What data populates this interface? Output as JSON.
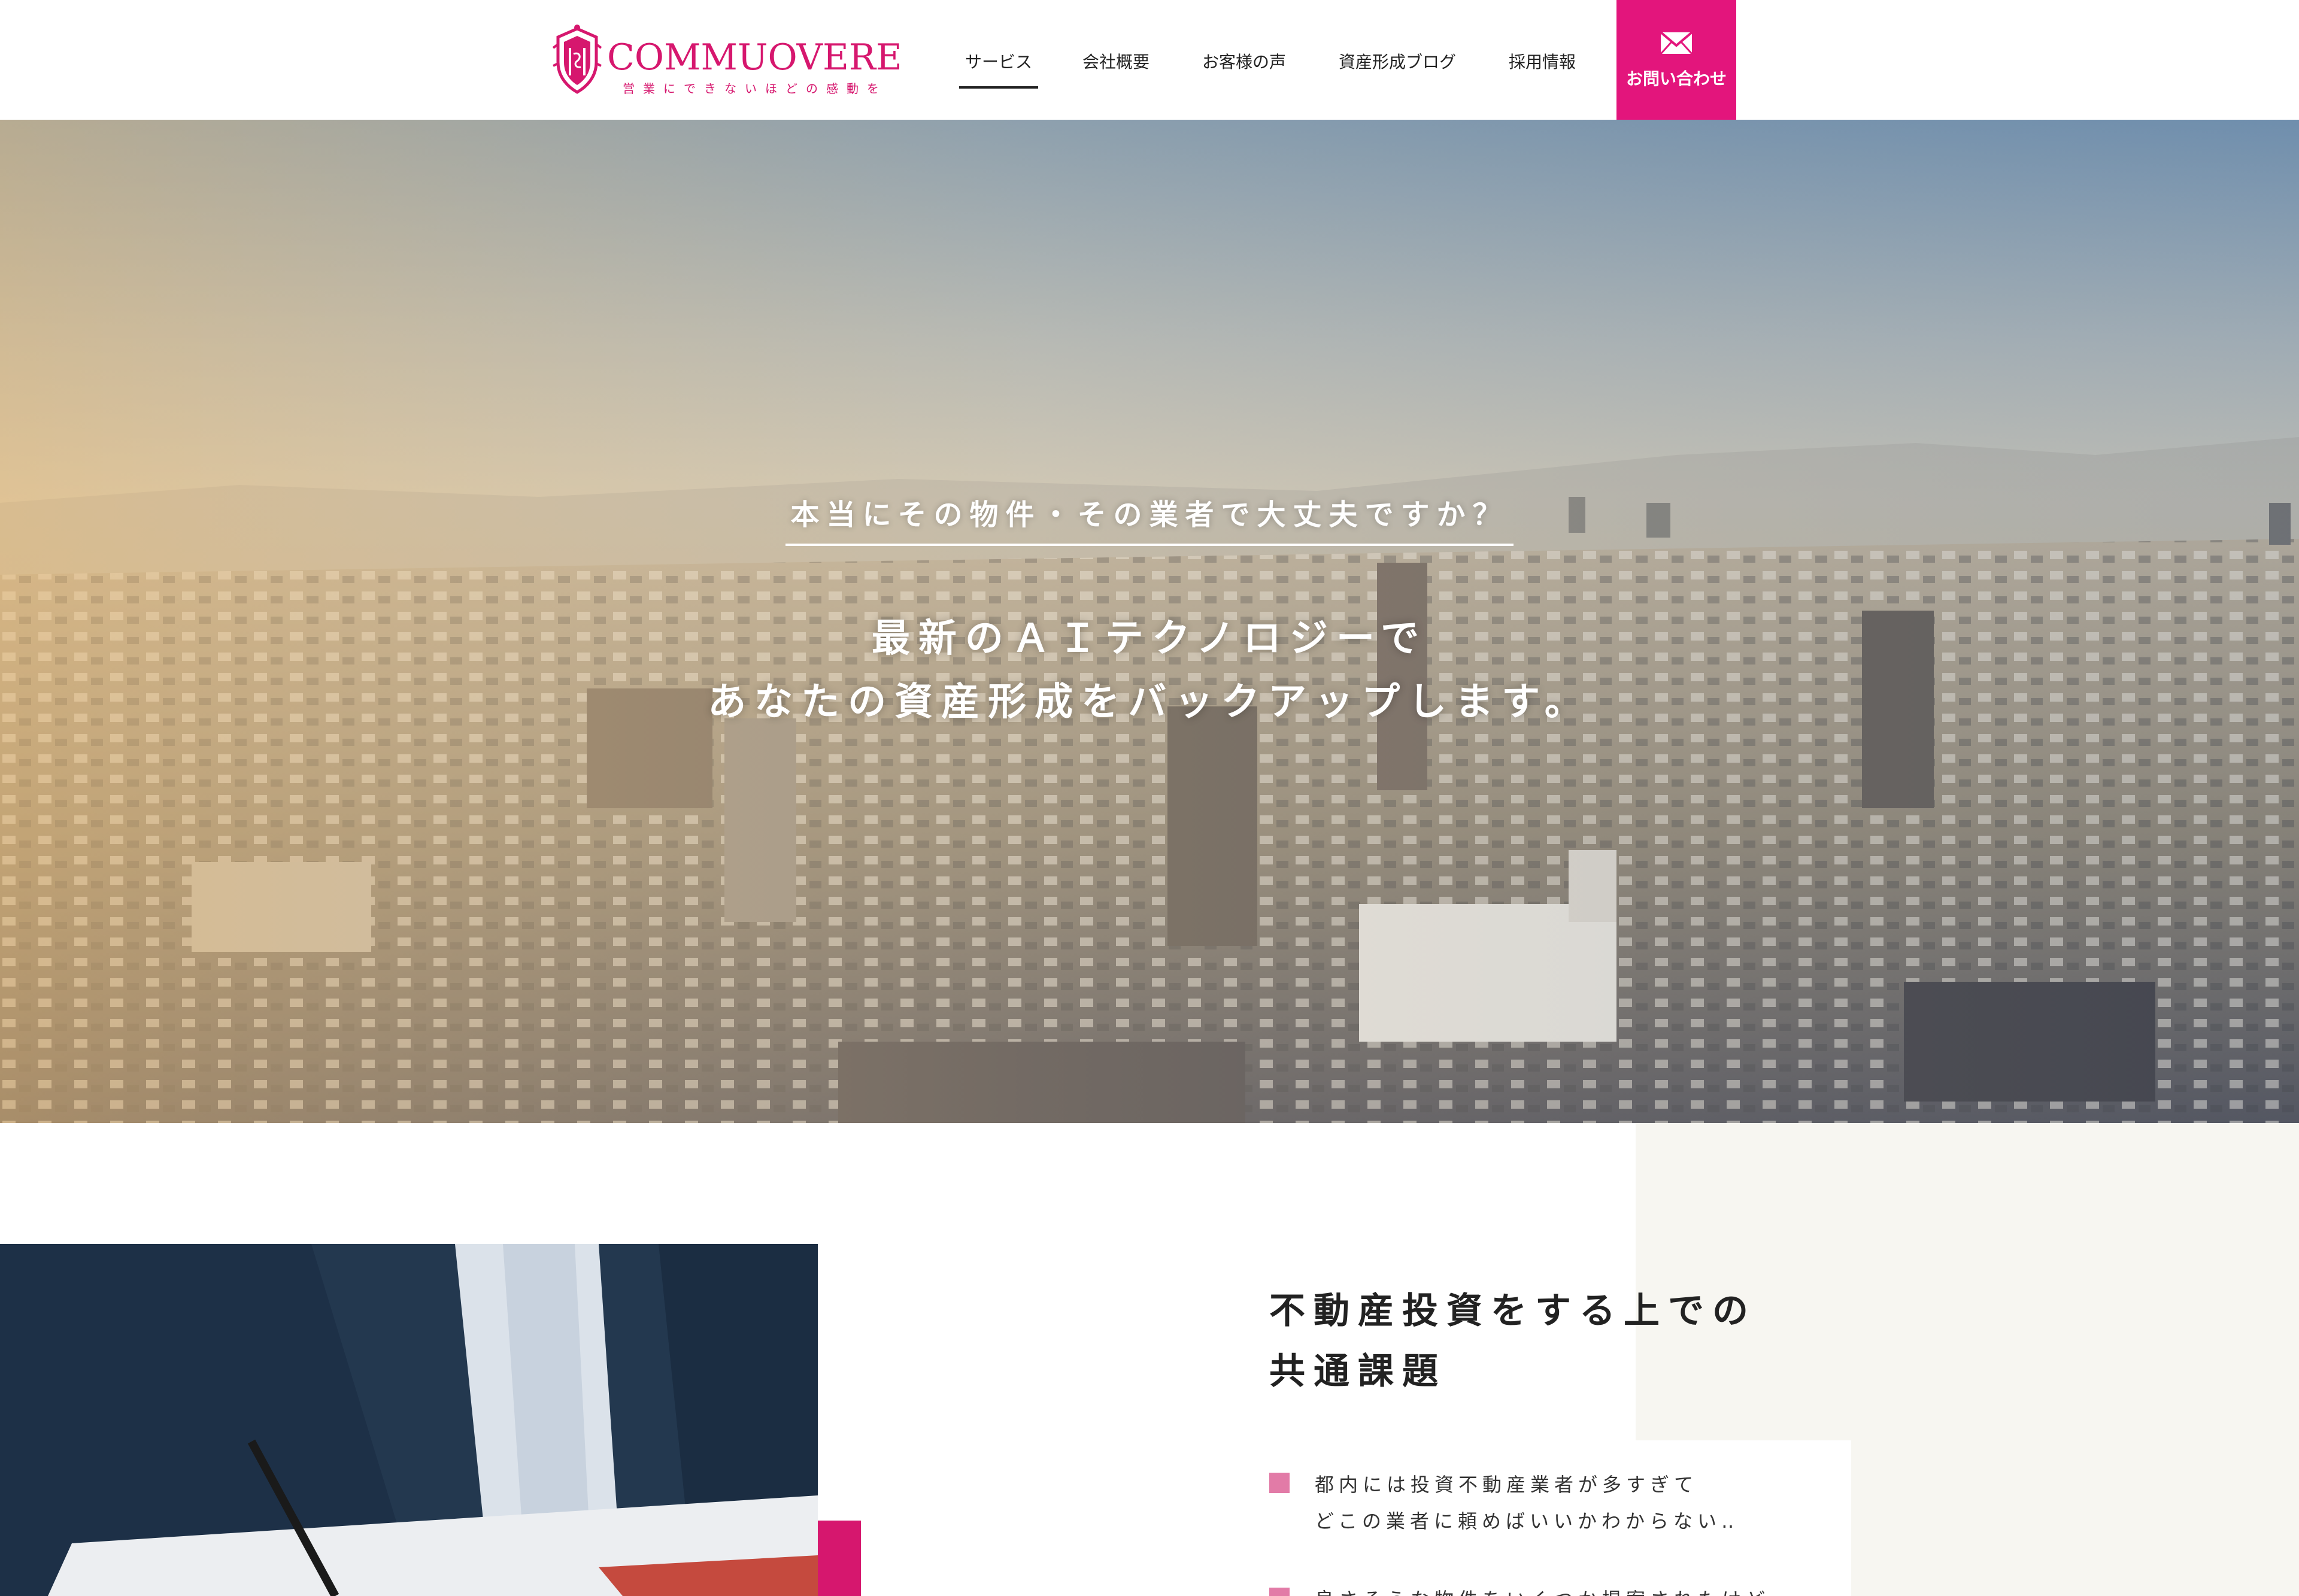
{
  "header": {
    "logo": {
      "name": "COMMUOVERE",
      "tagline": "営業にできないほどの感動を"
    },
    "nav": [
      {
        "label": "サービス",
        "active": true
      },
      {
        "label": "会社概要",
        "active": false
      },
      {
        "label": "お客様の声",
        "active": false
      },
      {
        "label": "資産形成ブログ",
        "active": false
      },
      {
        "label": "採用情報",
        "active": false
      }
    ],
    "contact": {
      "label": "お問い合わせ",
      "icon": "mail-icon"
    }
  },
  "hero": {
    "subtitle": "本当にその物件・その業者で大丈夫ですか？",
    "title_line1": "最新のＡＩテクノロジーで",
    "title_line2": "あなたの資産形成をバックアップします。"
  },
  "problems": {
    "title_line1": "不動産投資をする上での",
    "title_line2": "共通課題",
    "items": [
      {
        "line1": "都内には投資不動産業者が多すぎて",
        "line2": "どこの業者に頼めばいいかわからない‥"
      },
      {
        "line1": "良さそうな物件をいくつか提案されたけど",
        "line2": ""
      }
    ]
  },
  "colors": {
    "brand": "#d6176e",
    "contact_bg": "#e3157c",
    "bullet": "#e27ba7",
    "beige": "#f7f6f1"
  }
}
